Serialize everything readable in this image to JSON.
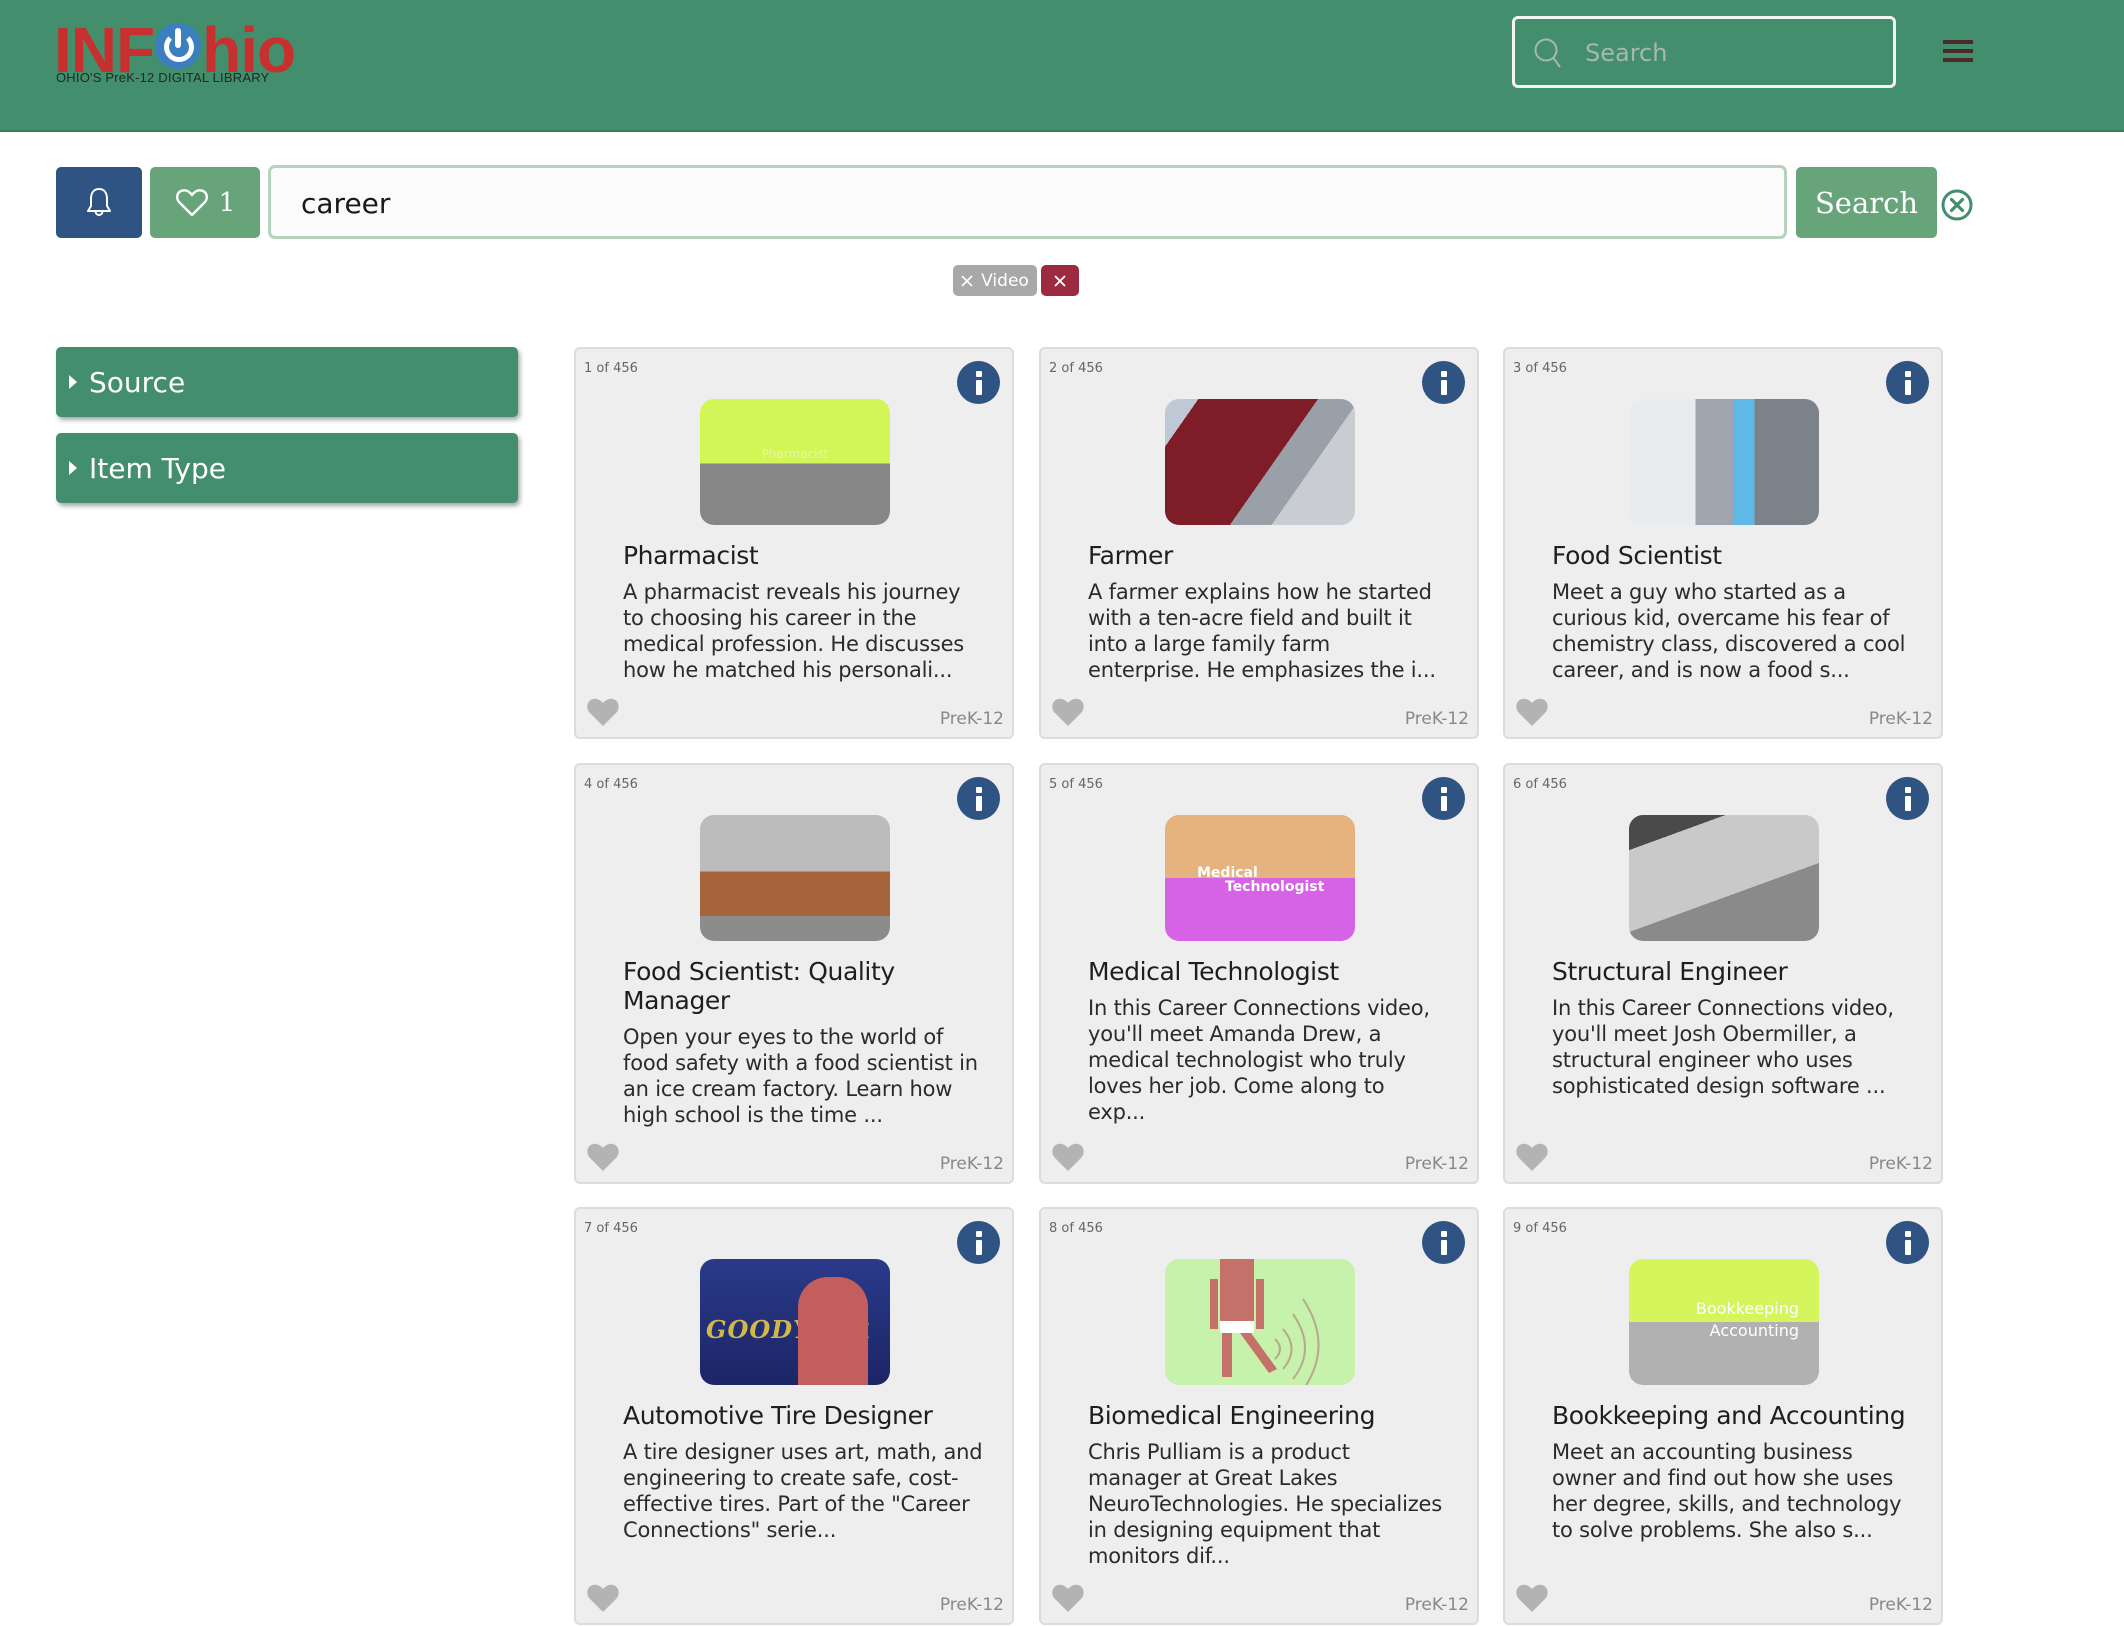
{
  "header": {
    "logo_text_left": "INF",
    "logo_text_right": "hio",
    "logo_tagline": "OHIO'S PreK-12 DIGITAL LIBRARY",
    "search_placeholder": "Search",
    "menu_icon": "hamburger-icon"
  },
  "colors": {
    "header_bg": "#438e6c",
    "primary_green": "#68a479",
    "bell_blue": "#2f5382",
    "chip_red": "#9c2a40",
    "chip_gray": "#a8a8a8",
    "card_bg": "#eeeeee"
  },
  "search_bar": {
    "bell_icon": "bell-icon",
    "favorites_icon": "heart-outline-icon",
    "favorites_count": "1",
    "query": "career",
    "search_button_label": "Search",
    "clear_icon": "circle-x-icon"
  },
  "active_filters": [
    {
      "label": "Video",
      "remove_icon": "close-icon"
    }
  ],
  "clear_filters_icon": "close-icon",
  "sidebar": {
    "facets": [
      {
        "label": "Source",
        "icon": "caret-right-icon"
      },
      {
        "label": "Item Type",
        "icon": "caret-right-icon"
      }
    ]
  },
  "results": {
    "total": "456",
    "items": [
      {
        "index": "1 of 456",
        "title": "Pharmacist",
        "description": "A pharmacist reveals his journey to choosing his career in the medical profession. He discusses how he matched his personali...",
        "grade": "PreK-12",
        "thumb_text": "Pharmacist"
      },
      {
        "index": "2 of 456",
        "title": "Farmer",
        "description": "A farmer explains how he started with a ten-acre field and built it into a large family farm enterprise. He emphasizes the i...",
        "grade": "PreK-12"
      },
      {
        "index": "3 of 456",
        "title": "Food Scientist",
        "description": "Meet a guy who started as a curious kid, overcame his fear of chemistry class, discovered a cool career, and is now a food s...",
        "grade": "PreK-12"
      },
      {
        "index": "4 of 456",
        "title": "Food Scientist: Quality Manager",
        "description": "Open your eyes to the world of food safety with a food scientist in an ice cream factory. Learn how high school is the time ...",
        "grade": "PreK-12"
      },
      {
        "index": "5 of 456",
        "title": "Medical Technologist",
        "description": "In this Career Connections video, you'll meet Amanda Drew, a medical technologist who truly loves her job. Come along to exp...",
        "grade": "PreK-12",
        "thumb_text_1": "Medical",
        "thumb_text_2": "Technologist"
      },
      {
        "index": "6 of 456",
        "title": "Structural Engineer",
        "description": "In this Career Connections video, you'll meet Josh Obermiller, a structural engineer who uses sophisticated design software ...",
        "grade": "PreK-12"
      },
      {
        "index": "7 of 456",
        "title": "Automotive Tire Designer",
        "description": "A tire designer uses art, math, and engineering to create safe, cost-effective tires. Part of the \"Career Connections\" serie...",
        "grade": "PreK-12",
        "thumb_text": "GOODYEAR"
      },
      {
        "index": "8 of 456",
        "title": "Biomedical Engineering",
        "description": "Chris Pulliam is a product manager at Great Lakes NeuroTechnologies. He specializes in designing equipment that monitors dif...",
        "grade": "PreK-12"
      },
      {
        "index": "9 of 456",
        "title": "Bookkeeping and Accounting",
        "description": "Meet an accounting business owner and find out how she uses her degree, skills, and technology to solve problems. She also s...",
        "grade": "PreK-12",
        "thumb_text_1": "Bookkeeping",
        "thumb_text_2": "Accounting"
      }
    ]
  }
}
